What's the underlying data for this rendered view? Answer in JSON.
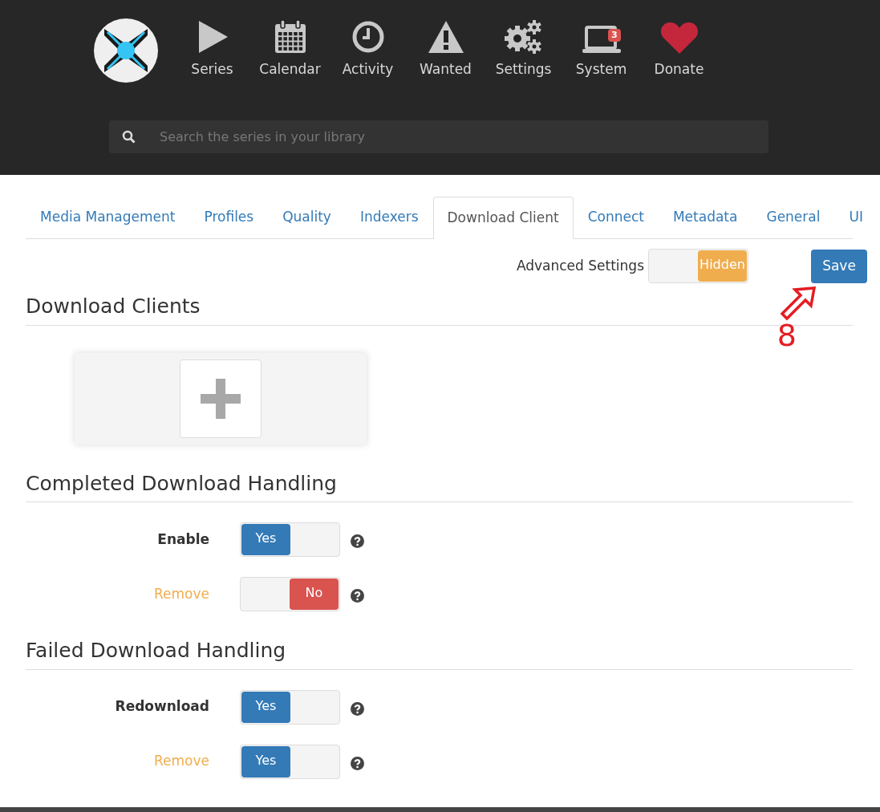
{
  "nav": [
    {
      "kind": "series",
      "label": "Series"
    },
    {
      "kind": "calendar",
      "label": "Calendar"
    },
    {
      "kind": "activity",
      "label": "Activity"
    },
    {
      "kind": "wanted",
      "label": "Wanted"
    },
    {
      "kind": "settings",
      "label": "Settings"
    },
    {
      "kind": "system",
      "label": "System",
      "badge": "3"
    },
    {
      "kind": "donate",
      "label": "Donate"
    }
  ],
  "search": {
    "placeholder": "Search the series in your library"
  },
  "tabs": [
    {
      "label": "Media Management",
      "selected": false
    },
    {
      "label": "Profiles",
      "selected": false
    },
    {
      "label": "Quality",
      "selected": false
    },
    {
      "label": "Indexers",
      "selected": false
    },
    {
      "label": "Download Client",
      "selected": true
    },
    {
      "label": "Connect",
      "selected": false
    },
    {
      "label": "Metadata",
      "selected": false
    },
    {
      "label": "General",
      "selected": false
    },
    {
      "label": "UI",
      "selected": false
    }
  ],
  "advanced_settings": {
    "label": "Advanced Settings",
    "on": false,
    "value": "Hidden"
  },
  "save_button": "Save",
  "annotation": {
    "label": "8"
  },
  "download_clients": {
    "title": "Download Clients"
  },
  "sections": [
    {
      "title": "Completed Download Handling",
      "fields": [
        {
          "label": "Enable",
          "advanced": false,
          "on": true,
          "value": "Yes"
        },
        {
          "label": "Remove",
          "advanced": true,
          "on": false,
          "value": "No"
        }
      ]
    },
    {
      "title": "Failed Download Handling",
      "fields": [
        {
          "label": "Redownload",
          "advanced": false,
          "on": true,
          "value": "Yes"
        },
        {
          "label": "Remove",
          "advanced": true,
          "on": true,
          "value": "Yes"
        }
      ]
    }
  ]
}
